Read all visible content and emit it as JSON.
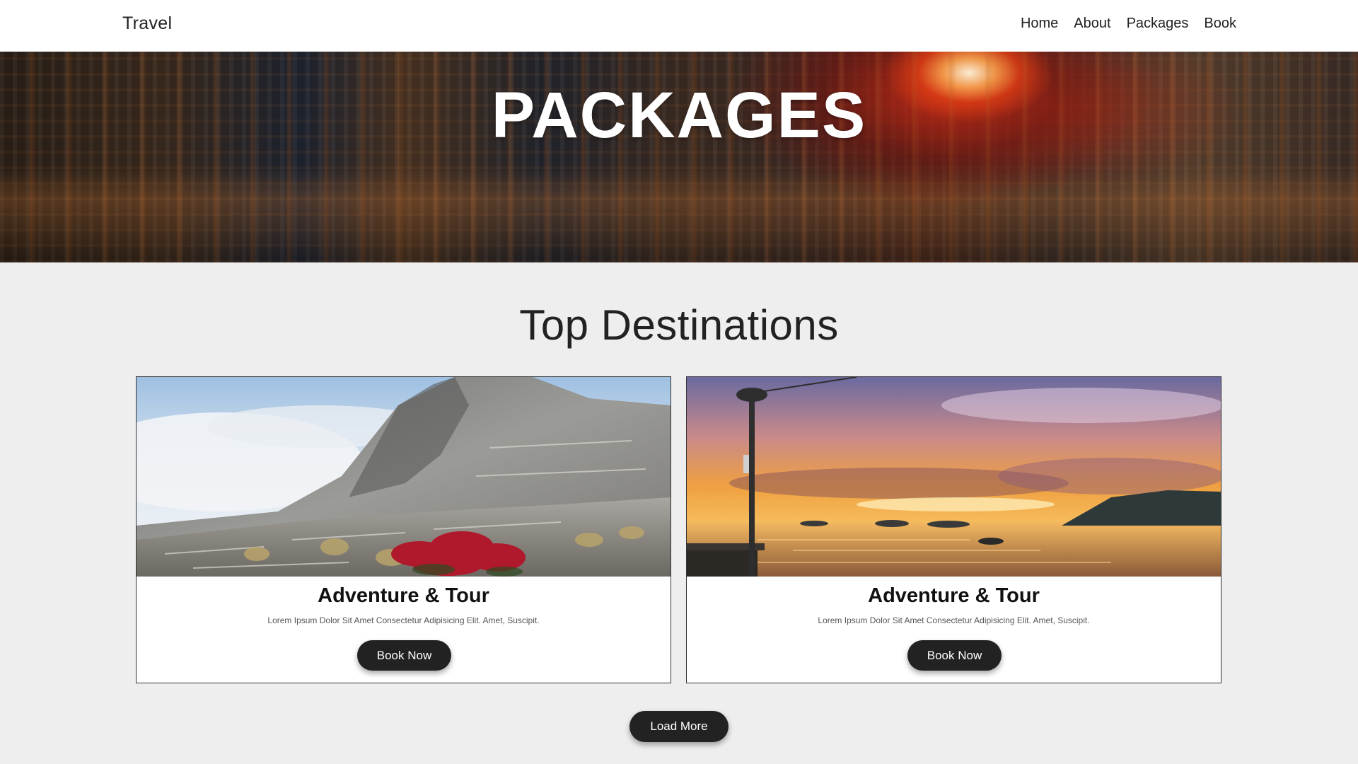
{
  "header": {
    "brand": "Travel",
    "nav": [
      "Home",
      "About",
      "Packages",
      "Book"
    ]
  },
  "hero": {
    "title": "PACKAGES"
  },
  "section": {
    "title": "Top Destinations"
  },
  "cards": [
    {
      "title": "Adventure & Tour",
      "text": "Lorem Ipsum Dolor Sit Amet Consectetur Adipisicing Elit. Amet, Suscipit.",
      "button": "Book Now"
    },
    {
      "title": "Adventure & Tour",
      "text": "Lorem Ipsum Dolor Sit Amet Consectetur Adipisicing Elit. Amet, Suscipit.",
      "button": "Book Now"
    }
  ],
  "load_more": "Load More",
  "colors": {
    "button_bg": "#222222",
    "page_bg": "#eeeeee",
    "header_bg": "#ffffff"
  }
}
